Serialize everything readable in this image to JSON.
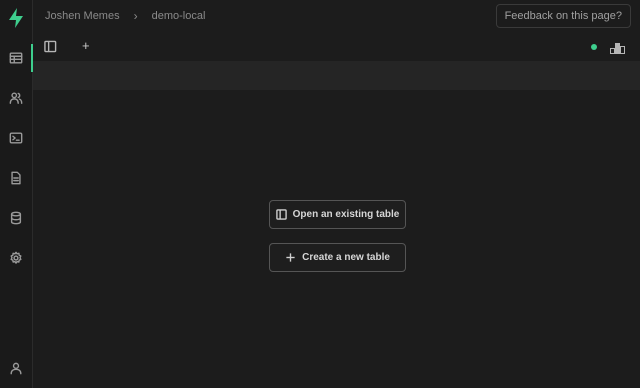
{
  "header": {
    "org": "Joshen Memes",
    "separator": "›",
    "project": "demo-local",
    "feedback_label": "Feedback on this page?"
  },
  "toolbar": {
    "add_label": "+"
  },
  "actions": {
    "open_table": "Open an existing table",
    "create_table": "Create a new table"
  },
  "colors": {
    "accent": "#3ecf8e",
    "background": "#1c1c1c"
  },
  "sidebar": {
    "items": [
      {
        "name": "table-editor",
        "icon": "table-icon"
      },
      {
        "name": "auth",
        "icon": "users-icon"
      },
      {
        "name": "sql-editor",
        "icon": "terminal-icon"
      },
      {
        "name": "api-docs",
        "icon": "document-icon"
      },
      {
        "name": "database",
        "icon": "database-icon"
      },
      {
        "name": "settings",
        "icon": "gear-icon"
      },
      {
        "name": "account",
        "icon": "user-icon"
      }
    ]
  }
}
